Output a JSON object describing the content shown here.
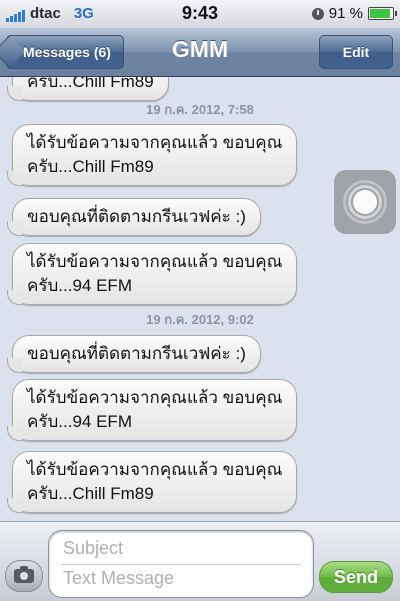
{
  "status_bar": {
    "carrier": "dtac",
    "network": "3G",
    "time": "9:43",
    "battery_text": "91 %",
    "battery_level": 0.91,
    "icons": [
      "signal-bars-icon",
      "clock-icon",
      "battery-icon"
    ]
  },
  "nav": {
    "back_label": "Messages (6)",
    "title": "GMM",
    "edit_label": "Edit"
  },
  "messages": {
    "partial_top": "ครับ...Chill Fm89",
    "items": [
      {
        "type": "timestamp",
        "text": "19 ก.ค. 2012, 7:58"
      },
      {
        "type": "bubble",
        "text": "ได้รับข้อความจากคุณแล้ว ขอบคุณ\nครับ...Chill Fm89"
      },
      {
        "type": "bubble",
        "text": "ขอบคุณที่ติดตามกรีนเวฟค่ะ :)"
      },
      {
        "type": "bubble",
        "text": "ได้รับข้อความจากคุณแล้ว ขอบคุณ\nครับ...94 EFM"
      },
      {
        "type": "timestamp",
        "text": "19 ก.ค. 2012, 9:02"
      },
      {
        "type": "bubble",
        "text": "ขอบคุณที่ติดตามกรีนเวฟค่ะ :)"
      },
      {
        "type": "bubble",
        "text": "ได้รับข้อความจากคุณแล้ว ขอบคุณ\nครับ...94 EFM"
      },
      {
        "type": "bubble",
        "text": "ได้รับข้อความจากคุณแล้ว ขอบคุณ\nครับ...Chill Fm89"
      }
    ]
  },
  "compose": {
    "subject_placeholder": "Subject",
    "message_placeholder": "Text Message",
    "send_label": "Send",
    "icons": [
      "camera-icon"
    ]
  },
  "colors": {
    "nav_bar": "#6d84a3",
    "background": "#dbe2ed",
    "send_green": "#6fbb4a"
  }
}
